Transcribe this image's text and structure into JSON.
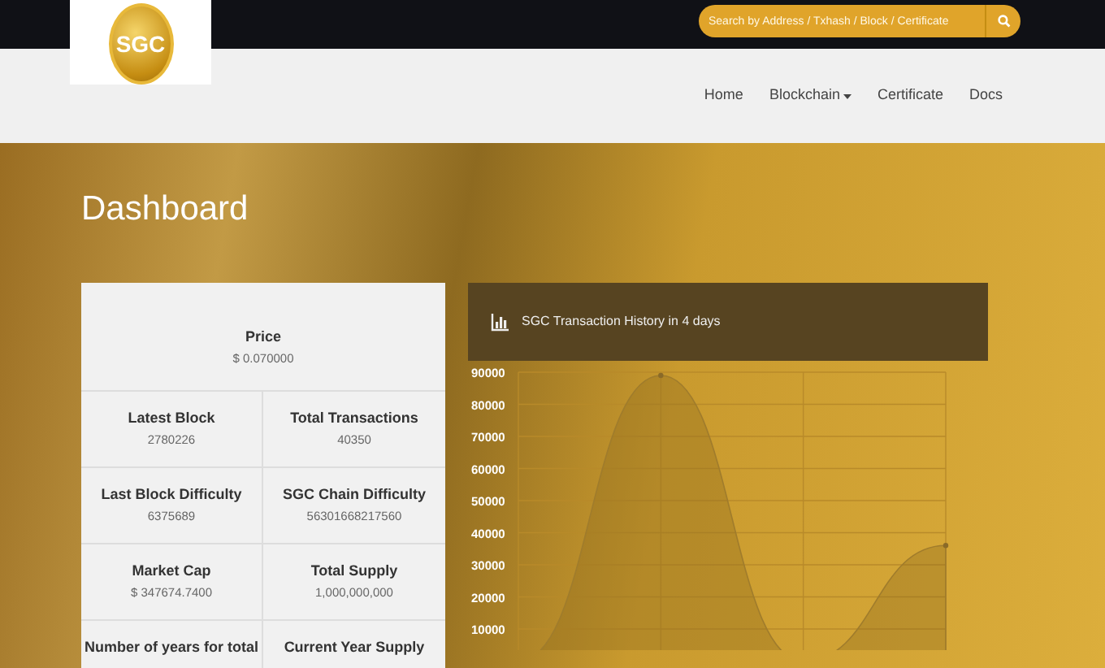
{
  "search": {
    "placeholder": "Search by Address / Txhash / Block / Certificate"
  },
  "logo": {
    "text": "SGC"
  },
  "nav": [
    {
      "label": "Home",
      "dropdown": false
    },
    {
      "label": "Blockchain",
      "dropdown": true
    },
    {
      "label": "Certificate",
      "dropdown": false
    },
    {
      "label": "Docs",
      "dropdown": false
    }
  ],
  "page_title": "Dashboard",
  "price": {
    "label": "Price",
    "value": "$ 0.070000"
  },
  "stats": [
    {
      "label": "Latest Block",
      "value": "2780226"
    },
    {
      "label": "Total Transactions",
      "value": "40350"
    },
    {
      "label": "Last Block Difficulty",
      "value": "6375689"
    },
    {
      "label": "SGC Chain Difficulty",
      "value": "56301668217560"
    },
    {
      "label": "Market Cap",
      "value": "$ 347674.7400"
    },
    {
      "label": "Total Supply",
      "value": "1,000,000,000"
    },
    {
      "label": "Number of years for total"
    },
    {
      "label": "Current Year Supply"
    }
  ],
  "chart_panel": {
    "title": "SGC Transaction History in 4 days",
    "chart_data": {
      "type": "area",
      "grid": true,
      "values": [
        0,
        89000,
        0,
        36000
      ],
      "ylim": [
        0,
        90000
      ],
      "yticks": [
        10000,
        20000,
        30000,
        40000,
        50000,
        60000,
        70000,
        80000,
        90000
      ]
    }
  }
}
